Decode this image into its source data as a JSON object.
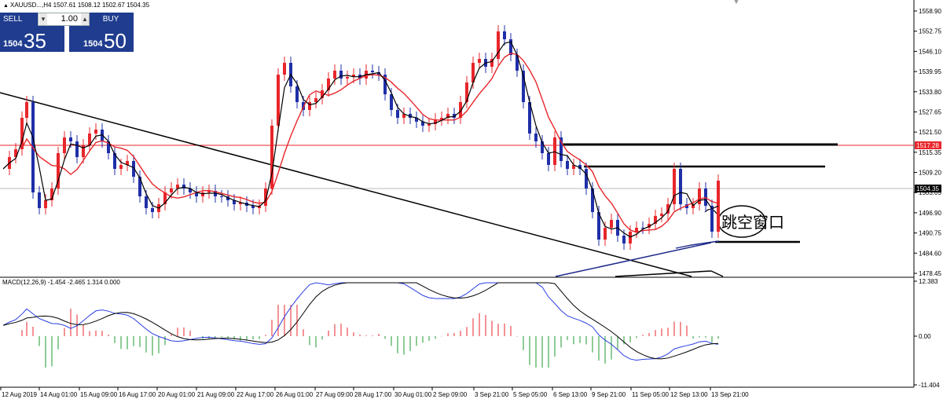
{
  "header": {
    "symbol_info": "XAUUSD...,H4  1507.61 1508.12 1502.67 1504.35",
    "macd_info": "MACD(12,26,9) -1.454 -2.465 1.314 0.000"
  },
  "trade": {
    "sell_label": "SELL",
    "buy_label": "BUY",
    "lot": "1.00",
    "sell_prefix": "1504",
    "sell_big": "35",
    "buy_prefix": "1504",
    "buy_big": "50",
    "lot_dec": "▾",
    "lot_inc": "▴"
  },
  "price_axis": {
    "ticks": [
      "1558.90",
      "1552.75",
      "1546.10",
      "1539.95",
      "1533.80",
      "1527.65",
      "1521.50",
      "1515.35",
      "1509.20",
      "1503.05",
      "1496.90",
      "1490.75",
      "1484.60",
      "1478.45"
    ],
    "current_price_label": "1504.35",
    "red_line_label": "1517.28"
  },
  "macd_axis": {
    "ticks": [
      "12.383",
      "0.00",
      "-11.404"
    ]
  },
  "time_axis": {
    "labels": [
      "12 Aug 2019",
      "14 Aug 01:00",
      "15 Aug 09:00",
      "16 Aug 17:00",
      "20 Aug 01:00",
      "21 Aug 09:00",
      "22 Aug 17:00",
      "26 Aug 01:00",
      "27 Aug 09:00",
      "28 Aug 17:00",
      "30 Aug 01:00",
      "2 Sep 09:00",
      "3 Sep 21:00",
      "5 Sep 05:00",
      "6 Sep 13:00",
      "9 Sep 21:00",
      "11 Sep 05:00",
      "12 Sep 13:00",
      "13 Sep 21:00"
    ]
  },
  "annotation": {
    "text": "跳空窗口"
  },
  "colors": {
    "bull": "#e8262b",
    "bear": "#1f2fa8",
    "ma_fast": "#000000",
    "ma_slow": "#e8262b",
    "ma_long": "#1f2a8a",
    "macd_main": "#2a3fe0",
    "macd_signal": "#000000",
    "hist_pos": "#e8262b",
    "hist_neg": "#1e9a2e",
    "accent": "#1f3c8f"
  }
}
